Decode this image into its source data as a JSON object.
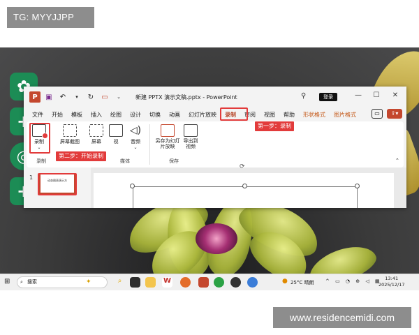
{
  "watermarks": {
    "top": "TG: MYYJJPP",
    "bottom": "www.residencemidi.com"
  },
  "window": {
    "doc_title": "新建 PPTX 演示文稿.pptx - PowerPoint",
    "login": "登录",
    "controls": [
      "—",
      "☐",
      "✕"
    ]
  },
  "tabs": [
    "文件",
    "开始",
    "模板",
    "插入",
    "绘图",
    "设计",
    "切换",
    "动画",
    "幻灯片放映",
    "录制",
    "审阅",
    "视图",
    "帮助",
    "形状格式",
    "图片格式"
  ],
  "active_tab": "录制",
  "ribbon": {
    "record": "录制",
    "screenshot": "屏幕截图",
    "screen": "屏幕",
    "video": "视",
    "audio": "音频",
    "save_as_show": "另存为幻灯片放映",
    "export_video": "导出到视频",
    "group_record": "录制",
    "group_media": "媒体",
    "group_save": "保存"
  },
  "callouts": {
    "step1": "第一步：录制",
    "step2": "第二步：开始录制"
  },
  "thumbnail": {
    "number": "1",
    "text": "动态图表演示方"
  },
  "taskbar": {
    "search": "搜索",
    "weather": "25°C 晴朗",
    "time": "13:41",
    "date": "2025/12/17"
  },
  "colors": {
    "accent": "#e23b3b",
    "ppt_red": "#c4472e",
    "green_dock": "#1c8c55"
  }
}
